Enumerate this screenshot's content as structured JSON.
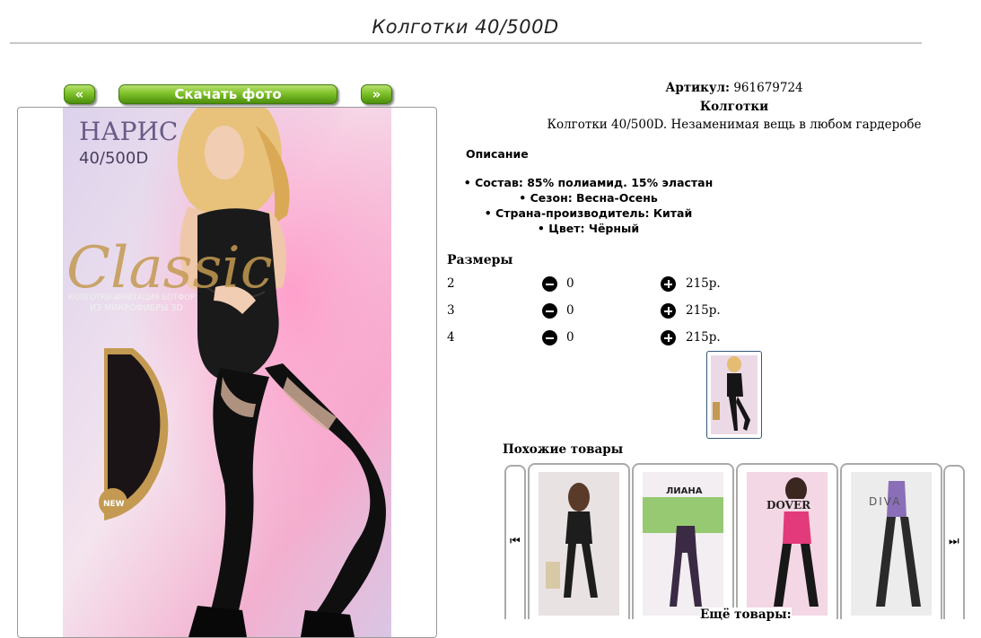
{
  "page": {
    "title": "Колготки 40/500D"
  },
  "gallery": {
    "prev_label": "«",
    "next_label": "»",
    "download_label": "Скачать фото"
  },
  "photo": {
    "brand": "НАРИС",
    "density": "40/500D",
    "series": "Classic",
    "tagline1": "КОЛГОТКИ-ИМИТАЦИЯ БОТФОР",
    "tagline2": "ИЗ МИКРОФИБРЫ 3D",
    "badge": "NEW"
  },
  "product": {
    "article_label": "Артикул:",
    "article": "961679724",
    "name": "Колготки",
    "description": "Колготки 40/500D. Незаменимая вещь в любом гардеробе"
  },
  "details": {
    "heading": "Описание",
    "items": [
      "Состав: 85% полиамид. 15% эластан",
      "Сезон: Весна-Осень",
      "Страна-производитель: Китай",
      "Цвет: Чёрный"
    ]
  },
  "sizes": {
    "heading": "Размеры",
    "rows": [
      {
        "size": "2",
        "qty": "0",
        "price": "215р."
      },
      {
        "size": "3",
        "qty": "0",
        "price": "215р."
      },
      {
        "size": "4",
        "qty": "0",
        "price": "215р."
      }
    ]
  },
  "similar": {
    "heading": "Похожие товары",
    "left_icon": "skip-previous-icon",
    "right_icon": "skip-next-icon",
    "cards": [
      {
        "brand": ""
      },
      {
        "brand": "ЛИАНА"
      },
      {
        "brand": "DOVER"
      },
      {
        "brand": "DIVA"
      }
    ],
    "more_label": "Ещё товары:"
  },
  "colors": {
    "button_green": "#7fc22a",
    "thumb_border": "#34577a",
    "gold": "#c49a52"
  }
}
